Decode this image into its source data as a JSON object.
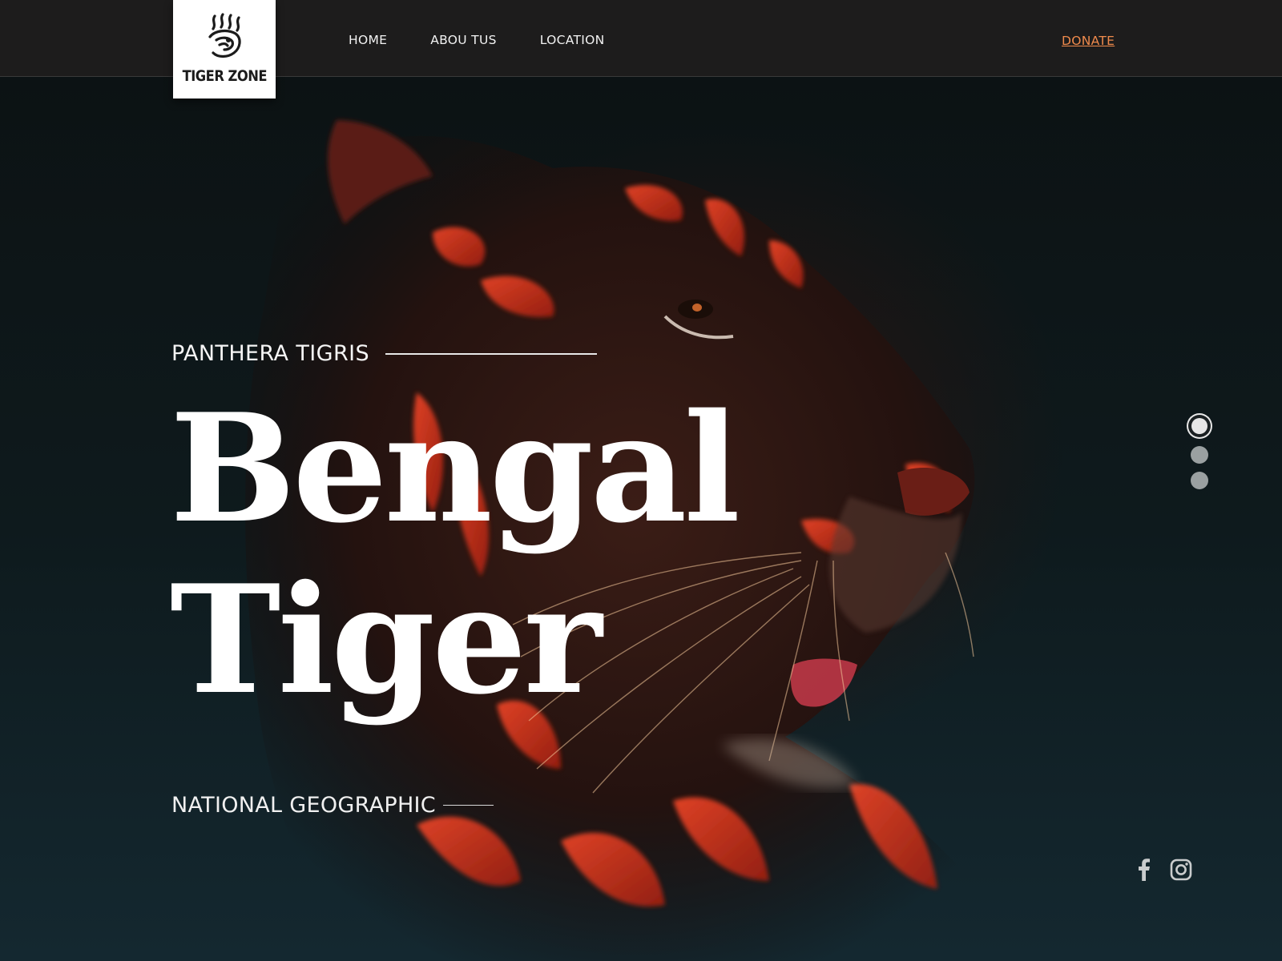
{
  "brand": {
    "name": "TIGER ZONE",
    "logo_icon": "tiger-head-icon"
  },
  "nav": {
    "items": [
      {
        "label": "HOME"
      },
      {
        "label": "ABOU TUS"
      },
      {
        "label": "LOCATION"
      }
    ],
    "donate_label": "DONATE"
  },
  "hero": {
    "eyebrow": "PANTHERA TIGRIS",
    "title_line1": "Bengal",
    "title_line2": "Tiger",
    "source": "NATIONAL GEOGRAPHIC",
    "background_image": "bengal-tiger-photo"
  },
  "slider": {
    "count": 3,
    "active_index": 0
  },
  "social": {
    "icons": [
      "facebook-icon",
      "instagram-icon"
    ]
  },
  "colors": {
    "accent": "#ef8a4c",
    "topbar": "#1d1c1c",
    "text": "#ffffff"
  }
}
